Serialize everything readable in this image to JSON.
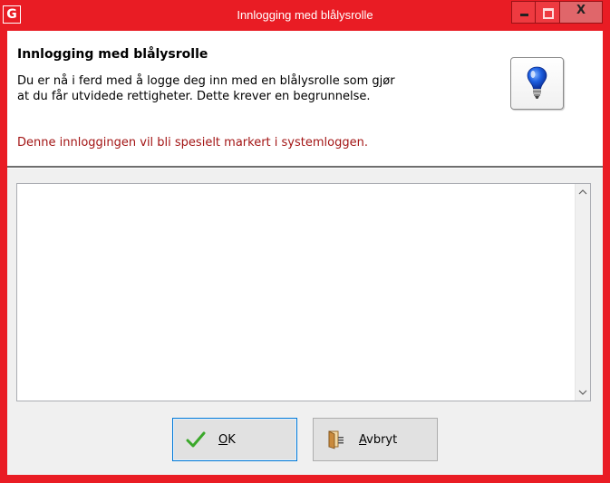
{
  "window": {
    "title": "Innlogging med blålysrolle",
    "app_icon_letter": "G",
    "frame_color": "#e91c24"
  },
  "header": {
    "title": "Innlogging med blålysrolle",
    "description_line1": "Du er nå i ferd med å logge deg inn med en blålysrolle som gjør",
    "description_line2": "at du får utvidede rettigheter. Dette krever en begrunnelse.",
    "warning": "Denne innloggingen vil bli spesielt markert i systemloggen.",
    "warning_color": "#a31515",
    "icon": "blue-lightbulb-icon"
  },
  "reason_input": {
    "value": "",
    "placeholder": ""
  },
  "buttons": {
    "ok": {
      "mnemonic": "O",
      "rest": "K",
      "icon": "checkmark-icon"
    },
    "cancel": {
      "mnemonic": "A",
      "rest": "vbryt",
      "icon": "door-exit-icon"
    }
  },
  "icons": {
    "minimize": "minimize-icon",
    "maximize": "maximize-icon",
    "close": "close-icon",
    "scroll_up": "scroll-up-arrow-icon",
    "scroll_down": "scroll-down-arrow-icon"
  }
}
